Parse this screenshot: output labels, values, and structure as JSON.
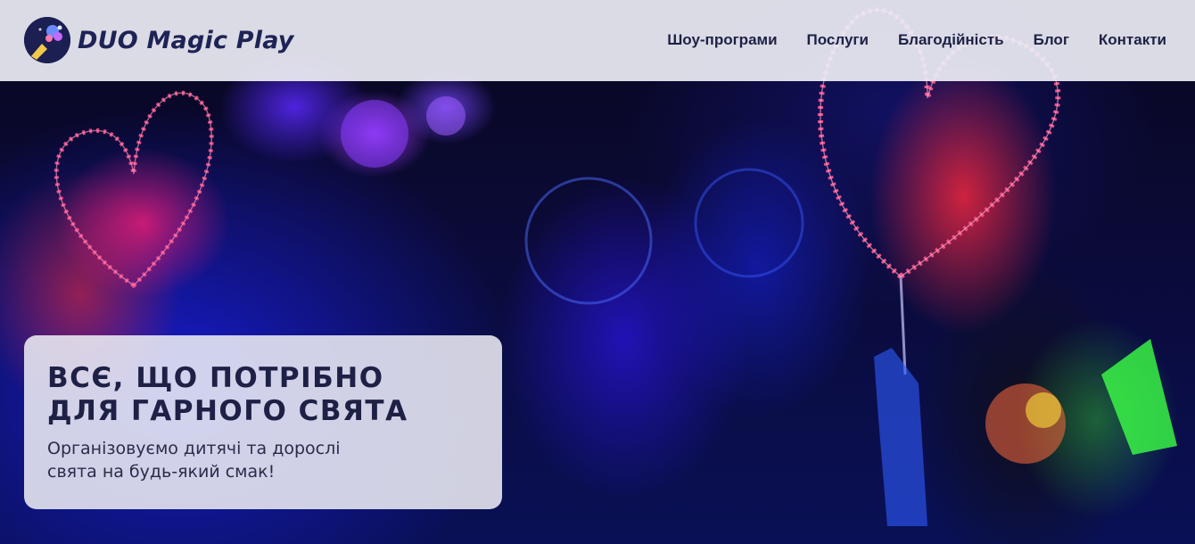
{
  "brand": {
    "name": "DUO Magic Play",
    "logo_icon": "magician-hat-wand-icon"
  },
  "nav": {
    "items": [
      {
        "label": "Шоу-програми"
      },
      {
        "label": "Послуги"
      },
      {
        "label": "Благодійність"
      },
      {
        "label": "Блог"
      },
      {
        "label": "Контакти"
      }
    ]
  },
  "hero": {
    "title_line1": "ВСЄ, ЩО ПОТРІБНО",
    "title_line2": "ДЛЯ ГАРНОГО СВЯТА",
    "subtitle_line1": "Організовуємо дитячі та дорослі",
    "subtitle_line2": "свята на будь-який смак!"
  },
  "colors": {
    "header_bg": "#ECECF4",
    "text_dark": "#1E2145",
    "accent_neon_pink": "#FF3C78",
    "accent_neon_blue": "#2A1EDC",
    "accent_neon_green": "#3CFF3C"
  }
}
